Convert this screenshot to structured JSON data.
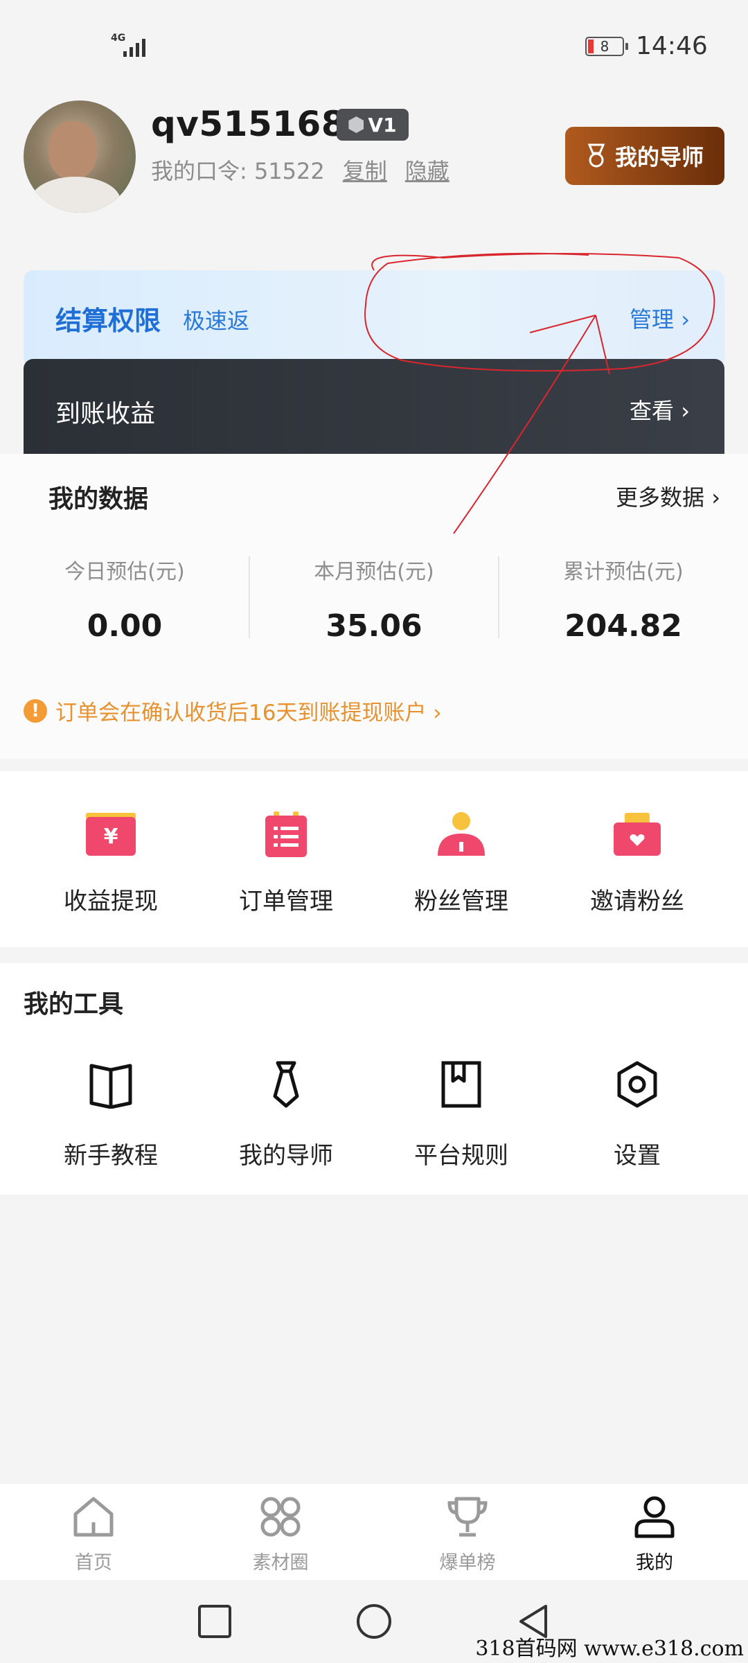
{
  "status_bar": {
    "network": "4G",
    "battery": "8",
    "time": "14:46"
  },
  "profile": {
    "username": "qv5151684",
    "level": "V1",
    "code_label": "我的口令: 51522",
    "copy_label": "复制",
    "hide_label": "隐藏",
    "mentor_button": "我的导师"
  },
  "settlement": {
    "title": "结算权限",
    "tag": "极速返",
    "manage_label": "管理 ›"
  },
  "arrival": {
    "title": "到账收益",
    "view_label": "查看 ›"
  },
  "my_data": {
    "title": "我的数据",
    "more_label": "更多数据 ›",
    "stats": [
      {
        "label": "今日预估(元)",
        "value": "0.00"
      },
      {
        "label": "本月预估(元)",
        "value": "35.06"
      },
      {
        "label": "累计预估(元)",
        "value": "204.82"
      }
    ],
    "notice": "订单会在确认收货后16天到账提现账户 ›",
    "notice_icon": "!"
  },
  "quick_actions": [
    {
      "label": "收益提现",
      "icon": "wallet-yen-icon"
    },
    {
      "label": "订单管理",
      "icon": "order-list-icon"
    },
    {
      "label": "粉丝管理",
      "icon": "fans-user-icon"
    },
    {
      "label": "邀请粉丝",
      "icon": "invite-envelope-icon"
    }
  ],
  "tools": {
    "title": "我的工具",
    "items": [
      {
        "label": "新手教程",
        "icon": "book-icon"
      },
      {
        "label": "我的导师",
        "icon": "tie-icon"
      },
      {
        "label": "平台规则",
        "icon": "bookmark-icon"
      },
      {
        "label": "设置",
        "icon": "settings-hex-icon"
      }
    ]
  },
  "bottom_nav": [
    {
      "label": "首页",
      "icon": "home-icon"
    },
    {
      "label": "素材圈",
      "icon": "clover-icon"
    },
    {
      "label": "爆单榜",
      "icon": "trophy-icon"
    },
    {
      "label": "我的",
      "icon": "person-icon",
      "active": true
    }
  ],
  "watermark": "318首码网  www.e318.com",
  "colors": {
    "accent_blue": "#1f6fd6",
    "brown": "#8b3f12",
    "notice_orange": "#e8912f",
    "action_pink": "#f0476d"
  }
}
